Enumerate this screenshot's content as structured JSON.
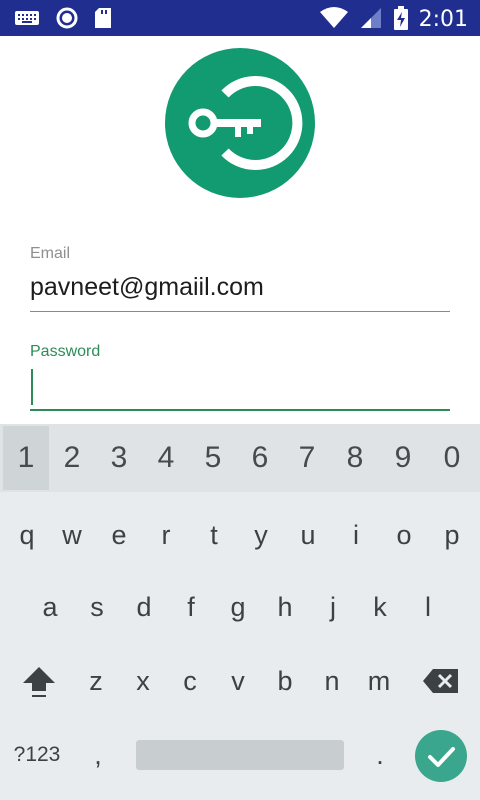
{
  "status_bar": {
    "time": "2:01",
    "icons": [
      "keyboard-icon",
      "circle-indicator-icon",
      "sd-card-icon",
      "wifi-icon",
      "signal-icon",
      "battery-charging-icon"
    ]
  },
  "form": {
    "email": {
      "label": "Email",
      "value": "pavneet@gmaiil.com"
    },
    "password": {
      "label": "Password",
      "value": ""
    }
  },
  "keyboard": {
    "number_row": [
      "1",
      "2",
      "3",
      "4",
      "5",
      "6",
      "7",
      "8",
      "9",
      "0"
    ],
    "row1": [
      "q",
      "w",
      "e",
      "r",
      "t",
      "y",
      "u",
      "i",
      "o",
      "p"
    ],
    "row2": [
      "a",
      "s",
      "d",
      "f",
      "g",
      "h",
      "j",
      "k",
      "l"
    ],
    "row3": [
      "z",
      "x",
      "c",
      "v",
      "b",
      "n",
      "m"
    ],
    "symbols_label": "?123",
    "comma": ",",
    "period": "."
  },
  "colors": {
    "status_bar": "#1f2e8f",
    "accent": "#129a71",
    "focus": "#2e8b57",
    "enter": "#3aa68e"
  }
}
